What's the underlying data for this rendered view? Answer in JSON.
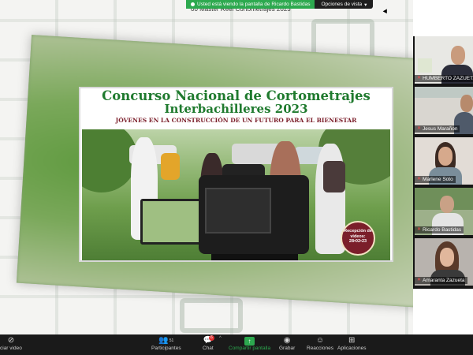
{
  "banner": {
    "sharing_text": "Usted está viendo la pantalla de Ricardo Bastidas",
    "view_options": "Opciones de vista"
  },
  "document_title": "00 Master Reel Cortometrajes 2023",
  "poster": {
    "title": "Concurso Nacional de Cortometrajes",
    "subtitle": "Interbachilleres 2023",
    "tagline": "JÓVENES EN LA CONSTRUCCIÓN DE UN FUTURO PARA EL BIENESTAR",
    "badge_text": "Recepción de videos:",
    "badge_date": "28•02•23"
  },
  "participants": [
    {
      "name": "HUMBERTO ZAZUETA",
      "mic_muted": true
    },
    {
      "name": "Jesus Marañon",
      "mic_muted": true
    },
    {
      "name": "Marlene Soto",
      "mic_muted": true
    },
    {
      "name": "Ricardo Bastidas",
      "mic_muted": true
    },
    {
      "name": "Amaranta Zazueta",
      "mic_muted": true
    }
  ],
  "toolbar": {
    "start_video": "ciar video",
    "participants_label": "Participantes",
    "participants_count": "51",
    "chat_label": "Chat",
    "chat_badge": "6",
    "share_label": "Compartir pantalla",
    "record_label": "Grabar",
    "reactions_label": "Reacciones",
    "apps_label": "Aplicaciones"
  },
  "colors": {
    "share_green": "#2da94f",
    "poster_green": "#1f7a2e",
    "poster_maroon": "#7b1e2a",
    "toolbar_bg": "#1a1a1a"
  }
}
